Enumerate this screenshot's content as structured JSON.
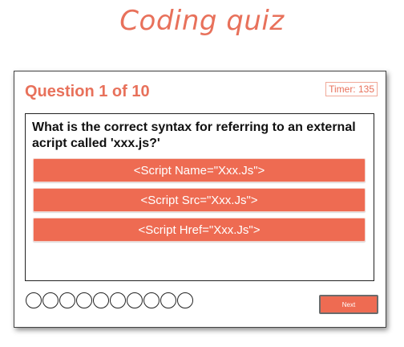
{
  "app": {
    "title": "Coding quiz"
  },
  "quiz": {
    "header": "Question 1 of 10",
    "timer": "Timer: 135",
    "question": "What is the correct syntax for referring to an external acript called 'xxx.js?'",
    "options": [
      "<Script Name=\"Xxx.Js\">",
      "<Script Src=\"Xxx.Js\">",
      "<Script Href=\"Xxx.Js\">"
    ],
    "progress": {
      "total": 10,
      "answered": 0
    },
    "next_label": "Next"
  },
  "colors": {
    "accent": "#ee6b52",
    "title": "#e8715b",
    "border": "#222222"
  }
}
